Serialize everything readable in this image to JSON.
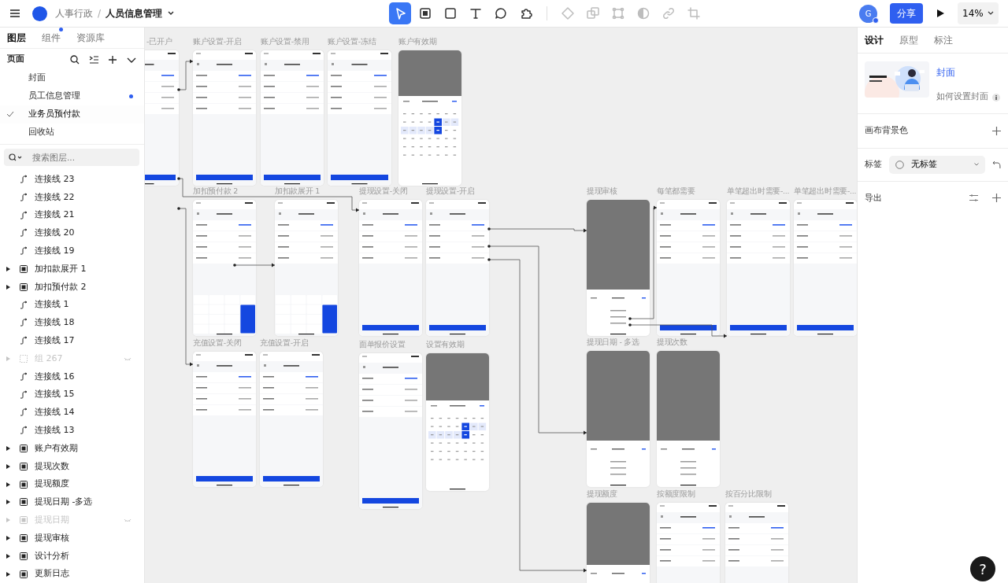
{
  "topbar": {
    "project": "人事行政",
    "separator": "/",
    "file": "人员信息管理",
    "avatar": "G",
    "share": "分享",
    "zoom": "14%"
  },
  "tools": [
    {
      "kind": "select",
      "selected": true
    },
    {
      "kind": "frame",
      "selected": false
    },
    {
      "kind": "rect",
      "selected": false
    },
    {
      "kind": "text",
      "selected": false
    },
    {
      "kind": "comment",
      "selected": false
    },
    {
      "kind": "plugin",
      "selected": false
    }
  ],
  "actions": [
    {
      "kind": "component",
      "disabled": true
    },
    {
      "kind": "boolean",
      "disabled": true
    },
    {
      "kind": "resize",
      "disabled": true
    },
    {
      "kind": "mask",
      "disabled": true
    },
    {
      "kind": "link",
      "disabled": true
    },
    {
      "kind": "crop",
      "disabled": true
    }
  ],
  "left_tabs": [
    {
      "label": "图层",
      "selected": true,
      "dot": false
    },
    {
      "label": "组件",
      "selected": false,
      "dot": true
    },
    {
      "label": "资源库",
      "selected": false,
      "dot": false
    }
  ],
  "pages": {
    "title": "页面",
    "items": [
      {
        "label": "封面",
        "selected": false,
        "dot": false
      },
      {
        "label": "员工信息管理",
        "selected": false,
        "dot": true
      },
      {
        "label": "业务员预付款",
        "selected": true,
        "dot": false
      },
      {
        "label": "回收站",
        "selected": false,
        "dot": false
      }
    ]
  },
  "layer_search": {
    "placeholder": "搜索图层..."
  },
  "layers": [
    {
      "label": "连接线 23",
      "kind": "connector",
      "hidden": false
    },
    {
      "label": "连接线 22",
      "kind": "connector",
      "hidden": false
    },
    {
      "label": "连接线 21",
      "kind": "connector",
      "hidden": false
    },
    {
      "label": "连接线 20",
      "kind": "connector",
      "hidden": false
    },
    {
      "label": "连接线 19",
      "kind": "connector",
      "hidden": false
    },
    {
      "label": "加扣款展开 1",
      "kind": "frame",
      "hidden": false
    },
    {
      "label": "加扣预付款 2",
      "kind": "frame",
      "hidden": false
    },
    {
      "label": "连接线 1",
      "kind": "connector",
      "hidden": false
    },
    {
      "label": "连接线 18",
      "kind": "connector",
      "hidden": false
    },
    {
      "label": "连接线 17",
      "kind": "connector",
      "hidden": false
    },
    {
      "label": "组 267",
      "kind": "group",
      "hidden": true
    },
    {
      "label": "连接线 16",
      "kind": "connector",
      "hidden": false
    },
    {
      "label": "连接线 15",
      "kind": "connector",
      "hidden": false
    },
    {
      "label": "连接线 14",
      "kind": "connector",
      "hidden": false
    },
    {
      "label": "连接线 13",
      "kind": "connector",
      "hidden": false
    },
    {
      "label": "账户有效期",
      "kind": "frame",
      "hidden": false
    },
    {
      "label": "提现次数",
      "kind": "frame",
      "hidden": false
    },
    {
      "label": "提现额度",
      "kind": "frame",
      "hidden": false
    },
    {
      "label": "提现日期 -多选",
      "kind": "frame",
      "hidden": false
    },
    {
      "label": "提现日期",
      "kind": "frame",
      "hidden": true
    },
    {
      "label": "提现审核",
      "kind": "frame",
      "hidden": false
    },
    {
      "label": "设计分析",
      "kind": "frame",
      "hidden": false
    },
    {
      "label": "更新日志",
      "kind": "frame",
      "hidden": false
    }
  ],
  "canvas": {
    "frames": [
      {
        "title": "-已开户",
        "kind": "form"
      },
      {
        "title": "账户设置-开启",
        "kind": "form"
      },
      {
        "title": "账户设置-禁用",
        "kind": "form"
      },
      {
        "title": "账户设置-冻结",
        "kind": "form"
      },
      {
        "title": "账户有效期",
        "kind": "calendar"
      },
      {
        "title": "加扣预付款 2",
        "kind": "keypad"
      },
      {
        "title": "加扣款展开 1",
        "kind": "keypad"
      },
      {
        "title": "提现设置-关闭",
        "kind": "form"
      },
      {
        "title": "提现设置-开启",
        "kind": "form"
      },
      {
        "title": "提现审核",
        "kind": "sheet"
      },
      {
        "title": "每笔都需要",
        "kind": "form"
      },
      {
        "title": "单笔超出时需要-...",
        "kind": "form"
      },
      {
        "title": "单笔超出时需要-...",
        "kind": "form"
      },
      {
        "title": "充值设置-关闭",
        "kind": "form"
      },
      {
        "title": "充值设置-开启",
        "kind": "form"
      },
      {
        "title": "面单报价设置",
        "kind": "form"
      },
      {
        "title": "设置有效期",
        "kind": "calendar"
      },
      {
        "title": "提现日期 - 多选",
        "kind": "sheet"
      },
      {
        "title": "提现次数",
        "kind": "sheet"
      },
      {
        "title": "提现额度",
        "kind": "sheet"
      },
      {
        "title": "按额度限制",
        "kind": "form"
      },
      {
        "title": "按百分比限制",
        "kind": "form"
      }
    ]
  },
  "right_tabs": [
    {
      "label": "设计",
      "selected": true
    },
    {
      "label": "原型",
      "selected": false
    },
    {
      "label": "标注",
      "selected": false
    }
  ],
  "cover": {
    "kind": "picture",
    "title": "封面",
    "help": "如何设置封面"
  },
  "background": {
    "label": "画布背景色"
  },
  "tag": {
    "label": "标签",
    "value": "无标签"
  },
  "export": {
    "label": "导出"
  },
  "help_button": "?"
}
